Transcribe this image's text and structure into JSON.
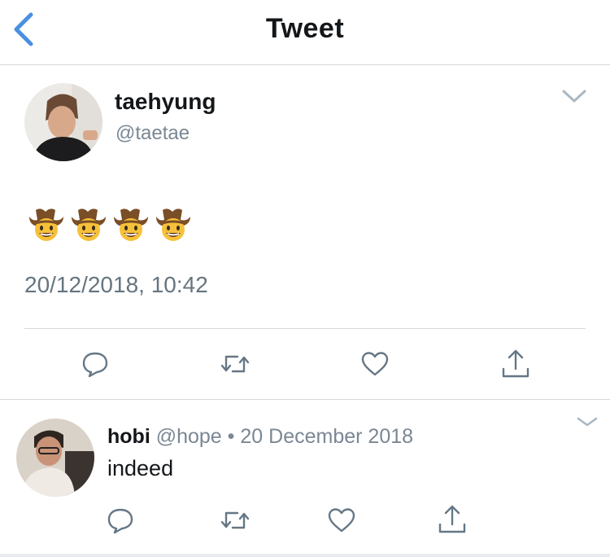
{
  "header": {
    "title": "Tweet"
  },
  "tweet": {
    "name": "taehyung",
    "handle": "@taetae",
    "content_emoji": [
      "cowboy-face",
      "cowboy-face",
      "cowboy-face",
      "cowboy-face"
    ],
    "timestamp": "20/12/2018, 10:42"
  },
  "reply": {
    "name": "hobi",
    "handle": "@hope",
    "separator": "•",
    "date": "20 December 2018",
    "text": "indeed"
  },
  "colors": {
    "accent": "#4a90e2",
    "icon_gray": "#657786",
    "muted": "#7a8794"
  }
}
